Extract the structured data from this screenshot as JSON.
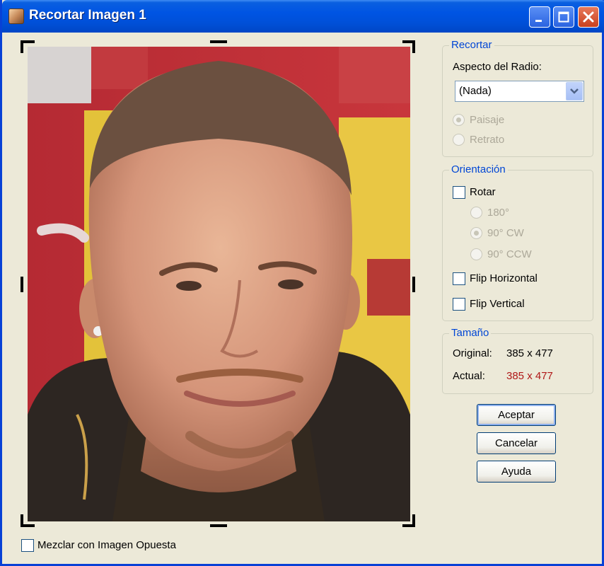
{
  "window": {
    "title": "Recortar Imagen 1",
    "icon": "photo-thumbnail-icon"
  },
  "recortar": {
    "legend": "Recortar",
    "aspect_label": "Aspecto del Radio:",
    "aspect_value": "(Nada)",
    "paisaje": "Paisaje",
    "retrato": "Retrato"
  },
  "orientacion": {
    "legend": "Orientación",
    "rotar": "Rotar",
    "r180": "180°",
    "r90cw": "90° CW",
    "r90ccw": "90° CCW",
    "flip_h": "Flip Horizontal",
    "flip_v": "Flip Vertical"
  },
  "tamano": {
    "legend": "Tamaño",
    "original_label": "Original:",
    "original_value": "385 x 477",
    "actual_label": "Actual:",
    "actual_value": "385 x 477"
  },
  "buttons": {
    "aceptar": "Aceptar",
    "cancelar": "Cancelar",
    "ayuda": "Ayuda"
  },
  "mezclar": "Mezclar con Imagen Opuesta",
  "colors": {
    "accent": "#0046d5",
    "actual_value": "#b01818",
    "titlebar": "#0054e3"
  }
}
